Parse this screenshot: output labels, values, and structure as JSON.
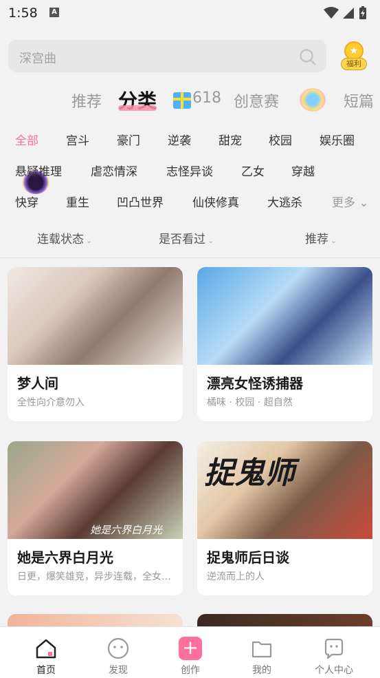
{
  "status_bar": {
    "time": "1:58",
    "notification_badge": "A"
  },
  "search": {
    "placeholder": "深宫曲",
    "reward_label": "福利"
  },
  "tabs": [
    {
      "label": "推荐",
      "active": false
    },
    {
      "label": "分类",
      "active": true
    },
    {
      "label": "618",
      "active": false
    },
    {
      "label": "创意赛",
      "active": false
    },
    {
      "label": "短篇",
      "active": false
    }
  ],
  "categories": [
    [
      "全部",
      "宫斗",
      "豪门",
      "逆袭",
      "甜宠",
      "校园",
      "娱乐圈"
    ],
    [
      "悬疑推理",
      "虐恋情深",
      "志怪异谈",
      "乙女",
      "穿越"
    ],
    [
      "快穿",
      "重生",
      "凹凸世界",
      "仙侠修真",
      "大逃杀"
    ]
  ],
  "categories_more": "更多",
  "filters": [
    {
      "label": "连载状态"
    },
    {
      "label": "是否看过"
    },
    {
      "label": "推荐"
    }
  ],
  "cards": [
    {
      "title": "梦人间",
      "subtitle": "全性向介意勿入"
    },
    {
      "title": "漂亮女怪诱捕器",
      "subtitle": "橘味 · 校园 · 超自然"
    },
    {
      "title": "她是六界白月光",
      "subtitle": "日更，爆笑雄竞，异步连载，全女主视角",
      "cover_text": "她是六界白月光"
    },
    {
      "title": "捉鬼师后日谈",
      "subtitle": "逆流而上的人",
      "cover_text": "捉鬼师"
    }
  ],
  "bottom_nav": [
    {
      "label": "首页",
      "icon": "home-icon",
      "active": true
    },
    {
      "label": "发现",
      "icon": "discover-icon",
      "active": false
    },
    {
      "label": "创作",
      "icon": "plus-icon",
      "active": false
    },
    {
      "label": "我的",
      "icon": "folder-icon",
      "active": false
    },
    {
      "label": "个人中心",
      "icon": "profile-icon",
      "active": false
    }
  ],
  "colors": {
    "accent": "#ff6f9b",
    "background": "#f2f2f2",
    "card": "#ffffff"
  }
}
